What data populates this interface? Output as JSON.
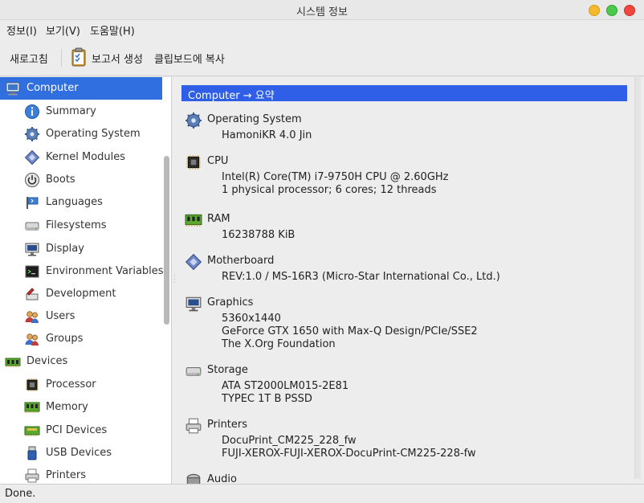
{
  "window": {
    "title": "시스템 정보"
  },
  "menubar": {
    "items": [
      "정보(I)",
      "보기(V)",
      "도움말(H)"
    ]
  },
  "toolbar": {
    "refresh": "새로고침",
    "report": "보고서 생성",
    "copy": "클립보드에 복사"
  },
  "sidebar": {
    "items": [
      {
        "label": "Computer",
        "icon": "computer-icon",
        "selected": true,
        "level": 0
      },
      {
        "label": "Summary",
        "icon": "info-icon",
        "level": 1
      },
      {
        "label": "Operating System",
        "icon": "gear-icon",
        "level": 1
      },
      {
        "label": "Kernel Modules",
        "icon": "module-icon",
        "level": 1
      },
      {
        "label": "Boots",
        "icon": "power-icon",
        "level": 1
      },
      {
        "label": "Languages",
        "icon": "flag-icon",
        "level": 1
      },
      {
        "label": "Filesystems",
        "icon": "drive-icon",
        "level": 1
      },
      {
        "label": "Display",
        "icon": "monitor-icon",
        "level": 1
      },
      {
        "label": "Environment Variables",
        "icon": "terminal-icon",
        "level": 1
      },
      {
        "label": "Development",
        "icon": "development-icon",
        "level": 1
      },
      {
        "label": "Users",
        "icon": "users-icon",
        "level": 1
      },
      {
        "label": "Groups",
        "icon": "groups-icon",
        "level": 1
      },
      {
        "label": "Devices",
        "icon": "devices-icon",
        "level": 0
      },
      {
        "label": "Processor",
        "icon": "cpu-icon",
        "level": 1
      },
      {
        "label": "Memory",
        "icon": "memory-icon",
        "level": 1
      },
      {
        "label": "PCI Devices",
        "icon": "pci-icon",
        "level": 1
      },
      {
        "label": "USB Devices",
        "icon": "usb-icon",
        "level": 1
      },
      {
        "label": "Printers",
        "icon": "printer-icon",
        "level": 1
      }
    ]
  },
  "content": {
    "header": "Computer → 요약",
    "sections": [
      {
        "title": "Operating System",
        "icon": "gear-icon",
        "lines": [
          "HamoniKR 4.0 Jin"
        ]
      },
      {
        "title": "CPU",
        "icon": "cpu-icon",
        "lines": [
          "Intel(R) Core(TM) i7-9750H CPU @ 2.60GHz",
          "1 physical processor; 6 cores; 12 threads"
        ]
      },
      {
        "title": "RAM",
        "icon": "memory-icon",
        "lines": [
          "16238788 KiB"
        ]
      },
      {
        "title": "Motherboard",
        "icon": "module-icon",
        "lines": [
          "REV:1.0 / MS-16R3 (Micro-Star International Co., Ltd.)"
        ]
      },
      {
        "title": "Graphics",
        "icon": "monitor-icon",
        "lines": [
          "5360x1440",
          "GeForce GTX 1650 with Max-Q Design/PCIe/SSE2",
          "The X.Org Foundation"
        ]
      },
      {
        "title": "Storage",
        "icon": "drive-icon",
        "lines": [
          "ATA ST2000LM015-2E81",
          "TYPEC 1T B PSSD"
        ]
      },
      {
        "title": "Printers",
        "icon": "printer-icon",
        "lines": [
          "DocuPrint_CM225_228_fw",
          "FUJI-XEROX-FUJI-XEROX-DocuPrint-CM225-228-fw"
        ]
      },
      {
        "title": "Audio",
        "icon": "audio-icon",
        "lines": []
      }
    ]
  },
  "status": {
    "text": "Done."
  }
}
